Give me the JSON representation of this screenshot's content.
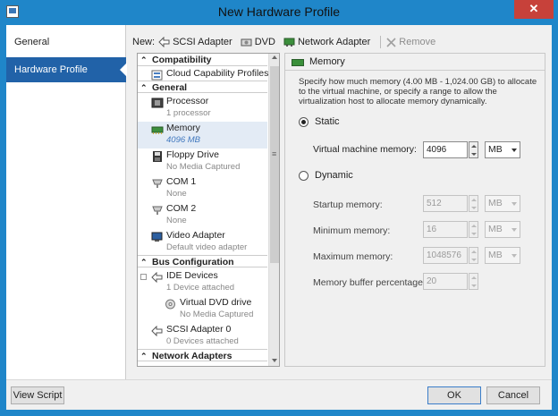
{
  "window": {
    "title": "New Hardware Profile",
    "close_glyph": "✕"
  },
  "nav": {
    "items": [
      {
        "label": "General"
      },
      {
        "label": "Hardware Profile"
      }
    ]
  },
  "toolbar": {
    "new_label": "New:",
    "scsi_label": "SCSI Adapter",
    "dvd_label": "DVD",
    "network_label": "Network Adapter",
    "remove_label": "Remove"
  },
  "tree": {
    "sections": {
      "compatibility": "Compatibility",
      "general": "General",
      "bus": "Bus Configuration",
      "network": "Network Adapters"
    },
    "items": {
      "cloud": {
        "name": "Cloud Capability Profiles"
      },
      "processor": {
        "name": "Processor",
        "sub": "1 processor"
      },
      "memory": {
        "name": "Memory",
        "sub": "4096 MB"
      },
      "floppy": {
        "name": "Floppy Drive",
        "sub": "No Media Captured"
      },
      "com1": {
        "name": "COM 1",
        "sub": "None"
      },
      "com2": {
        "name": "COM 2",
        "sub": "None"
      },
      "video": {
        "name": "Video Adapter",
        "sub": "Default video adapter"
      },
      "ide": {
        "name": "IDE Devices",
        "sub": "1 Device attached"
      },
      "dvd": {
        "name": "Virtual DVD drive",
        "sub": "No Media Captured"
      },
      "scsi": {
        "name": "SCSI Adapter 0",
        "sub": "0 Devices attached"
      }
    }
  },
  "detail": {
    "header": "Memory",
    "description": "Specify how much memory (4.00 MB - 1,024.00 GB) to allocate to the virtual machine, or specify a range to allow the virtualization host to allocate memory dynamically.",
    "static_label": "Static",
    "dynamic_label": "Dynamic",
    "static_selected": true,
    "vm_memory_label": "Virtual machine memory:",
    "vm_memory_value": "4096",
    "vm_memory_unit": "MB",
    "startup_label": "Startup memory:",
    "startup_value": "512",
    "startup_unit": "MB",
    "minimum_label": "Minimum memory:",
    "minimum_value": "16",
    "minimum_unit": "MB",
    "maximum_label": "Maximum memory:",
    "maximum_value": "1048576",
    "maximum_unit": "MB",
    "buffer_label": "Memory buffer percentage:",
    "buffer_value": "20"
  },
  "buttons": {
    "view_script": "View Script",
    "ok": "OK",
    "cancel": "Cancel"
  }
}
